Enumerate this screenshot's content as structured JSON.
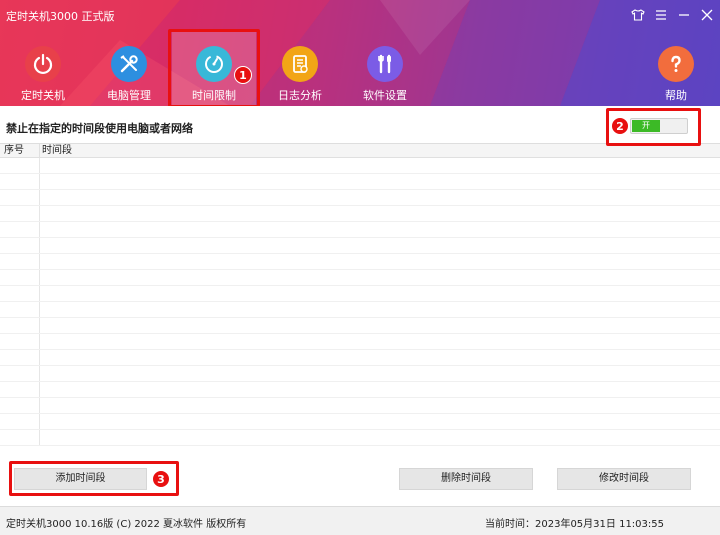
{
  "window": {
    "title": "定时关机3000 正式版",
    "controls": [
      "skin",
      "menu",
      "minimize",
      "close"
    ]
  },
  "nav": {
    "items": [
      {
        "label": "定时关机",
        "icon": "power-icon",
        "color": "#e8404a"
      },
      {
        "label": "电脑管理",
        "icon": "tools-icon",
        "color": "#2d8fe0"
      },
      {
        "label": "时间限制",
        "icon": "timer-icon",
        "color": "#38b8d8",
        "active": true
      },
      {
        "label": "日志分析",
        "icon": "log-document-icon",
        "color": "#f2a516"
      },
      {
        "label": "软件设置",
        "icon": "settings-tools-icon",
        "color": "#7b5ce6"
      }
    ],
    "help_label": "帮助",
    "help_color": "#f26d3d"
  },
  "main": {
    "rule_title": "禁止在指定的时间段使用电脑或者网络",
    "toggle_label": "开",
    "toggle_on": true,
    "table": {
      "columns": [
        "序号",
        "时间段"
      ],
      "rows": []
    },
    "buttons": {
      "add": "添加时间段",
      "delete": "删除时间段",
      "modify": "修改时间段"
    }
  },
  "annotations": {
    "badge1": "1",
    "badge2": "2",
    "badge3": "3",
    "color": "#e81010"
  },
  "footer": {
    "copyright": "定时关机3000 10.16版 (C) 2022  夏冰软件 版权所有",
    "current_time": "当前时间：2023年05月31日 11:03:55"
  }
}
